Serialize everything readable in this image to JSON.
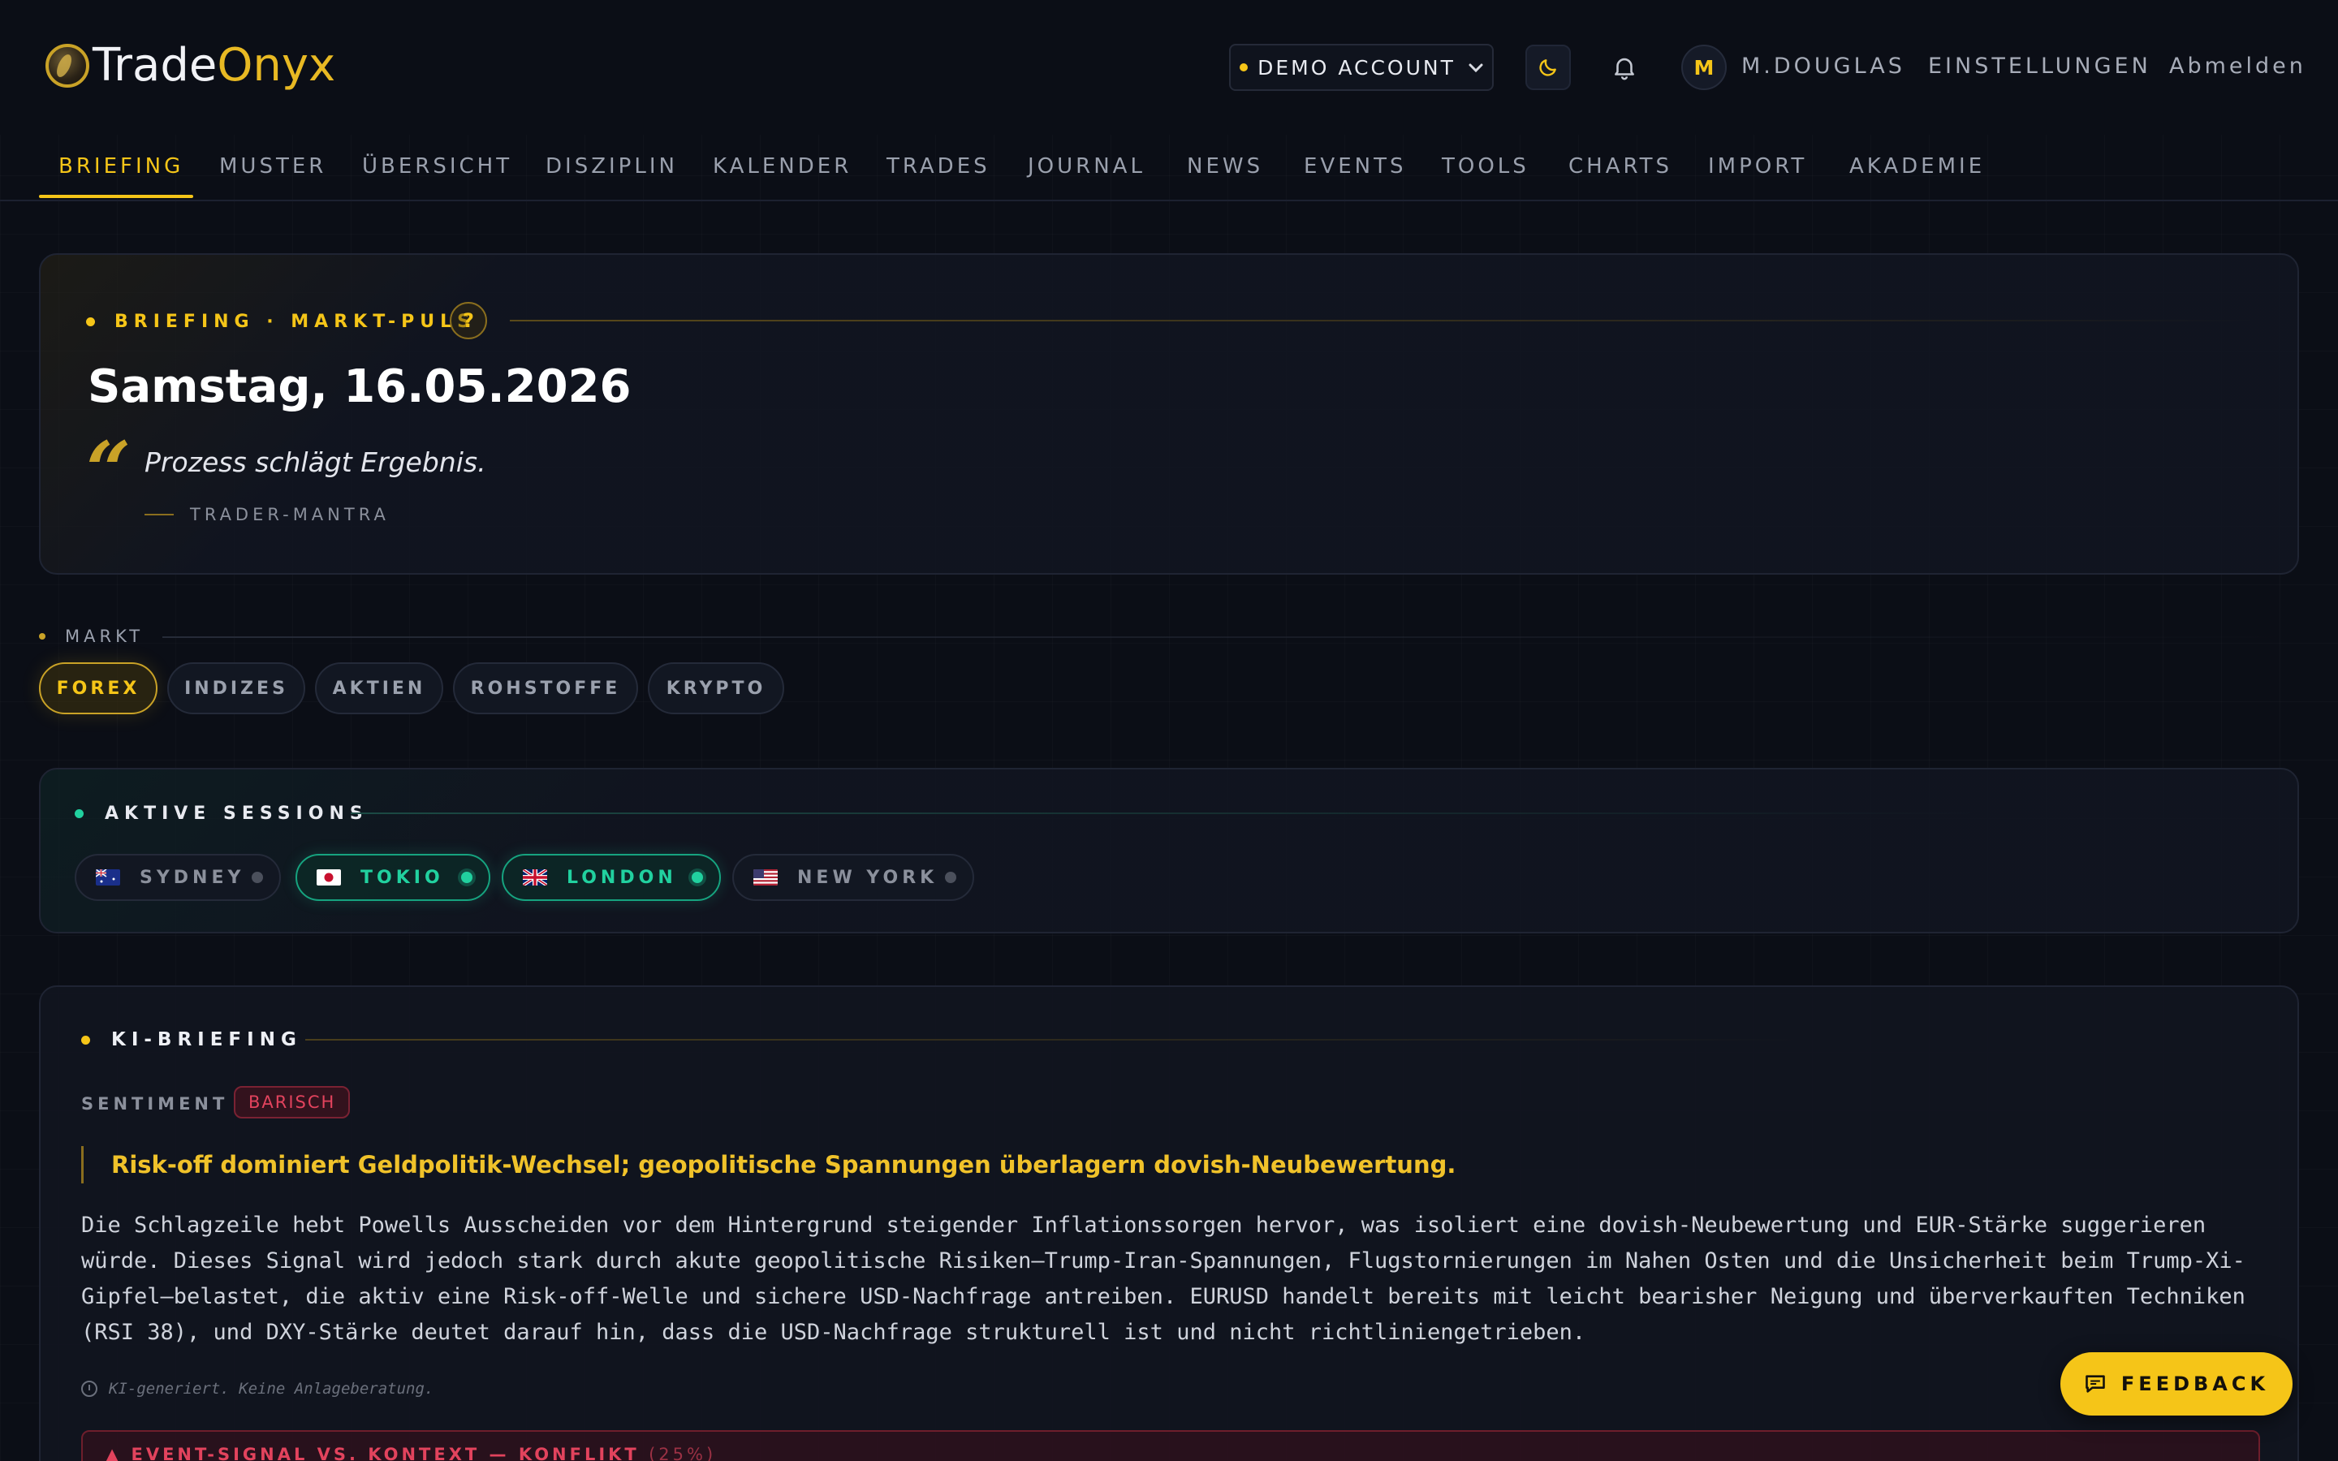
{
  "header": {
    "logo_part1": "Trade",
    "logo_part2": "Onyx",
    "account_label": "DEMO ACCOUNT",
    "avatar_initial": "M",
    "username": "M.DOUGLAS",
    "settings_label": "EINSTELLUNGEN",
    "logout_label": "Abmelden"
  },
  "nav": {
    "items": [
      "BRIEFING",
      "MUSTER",
      "ÜBERSICHT",
      "DISZIPLIN",
      "KALENDER",
      "TRADES",
      "JOURNAL",
      "NEWS",
      "EVENTS",
      "TOOLS",
      "CHARTS",
      "IMPORT",
      "AKADEMIE"
    ],
    "active": "BRIEFING"
  },
  "briefing": {
    "kicker": "BRIEFING · MARKT-PULS",
    "help": "?",
    "date": "Samstag, 16.05.2026",
    "quote_mark": "“",
    "quote": "Prozess schlägt Ergebnis.",
    "quote_attr": "TRADER-MANTRA"
  },
  "markt": {
    "label": "MARKT",
    "options": [
      "FOREX",
      "INDIZES",
      "AKTIEN",
      "ROHSTOFFE",
      "KRYPTO"
    ],
    "active": "FOREX"
  },
  "sessions": {
    "title": "AKTIVE SESSIONS",
    "items": [
      {
        "name": "SYDNEY",
        "active": false,
        "flag": "au-flag"
      },
      {
        "name": "TOKIO",
        "active": true,
        "flag": "jp-flag"
      },
      {
        "name": "LONDON",
        "active": true,
        "flag": "gb-flag"
      },
      {
        "name": "NEW YORK",
        "active": false,
        "flag": "us-flag"
      }
    ]
  },
  "ki": {
    "title": "KI-BRIEFING",
    "sentiment_label": "SENTIMENT",
    "sentiment_value": "BARISCH",
    "headline": "Risk-off dominiert Geldpolitik-Wechsel; geopolitische Spannungen überlagern dovish-Neubewertung.",
    "body": "Die Schlagzeile hebt Powells Ausscheiden vor dem Hintergrund steigender Inflationssorgen hervor, was isoliert eine dovish-Neubewertung und EUR-Stärke suggerieren würde. Dieses Signal wird jedoch stark durch akute geopolitische Risiken—Trump-Iran-Spannungen, Flugstornierungen im Nahen Osten und die Unsicherheit beim Trump-Xi-Gipfel—belastet, die aktiv eine Risk-off-Welle und sichere USD-Nachfrage antreiben. EURUSD handelt bereits mit leicht bearisher Neigung und überverkauften Techniken (RSI 38), und DXY-Stärke deutet darauf hin, dass die USD-Nachfrage strukturell ist und nicht richtliniengetrieben.",
    "disclaimer": "KI-generiert. Keine Anlageberatung.",
    "conflict_label": "EVENT-SIGNAL VS. KONTEXT — KONFLIKT",
    "conflict_pct": "(25%)"
  },
  "feedback_label": "FEEDBACK",
  "colors": {
    "accent": "#f5c518",
    "session_active": "#21d19f",
    "bearish": "#e2435d",
    "background": "#0b0e16"
  }
}
